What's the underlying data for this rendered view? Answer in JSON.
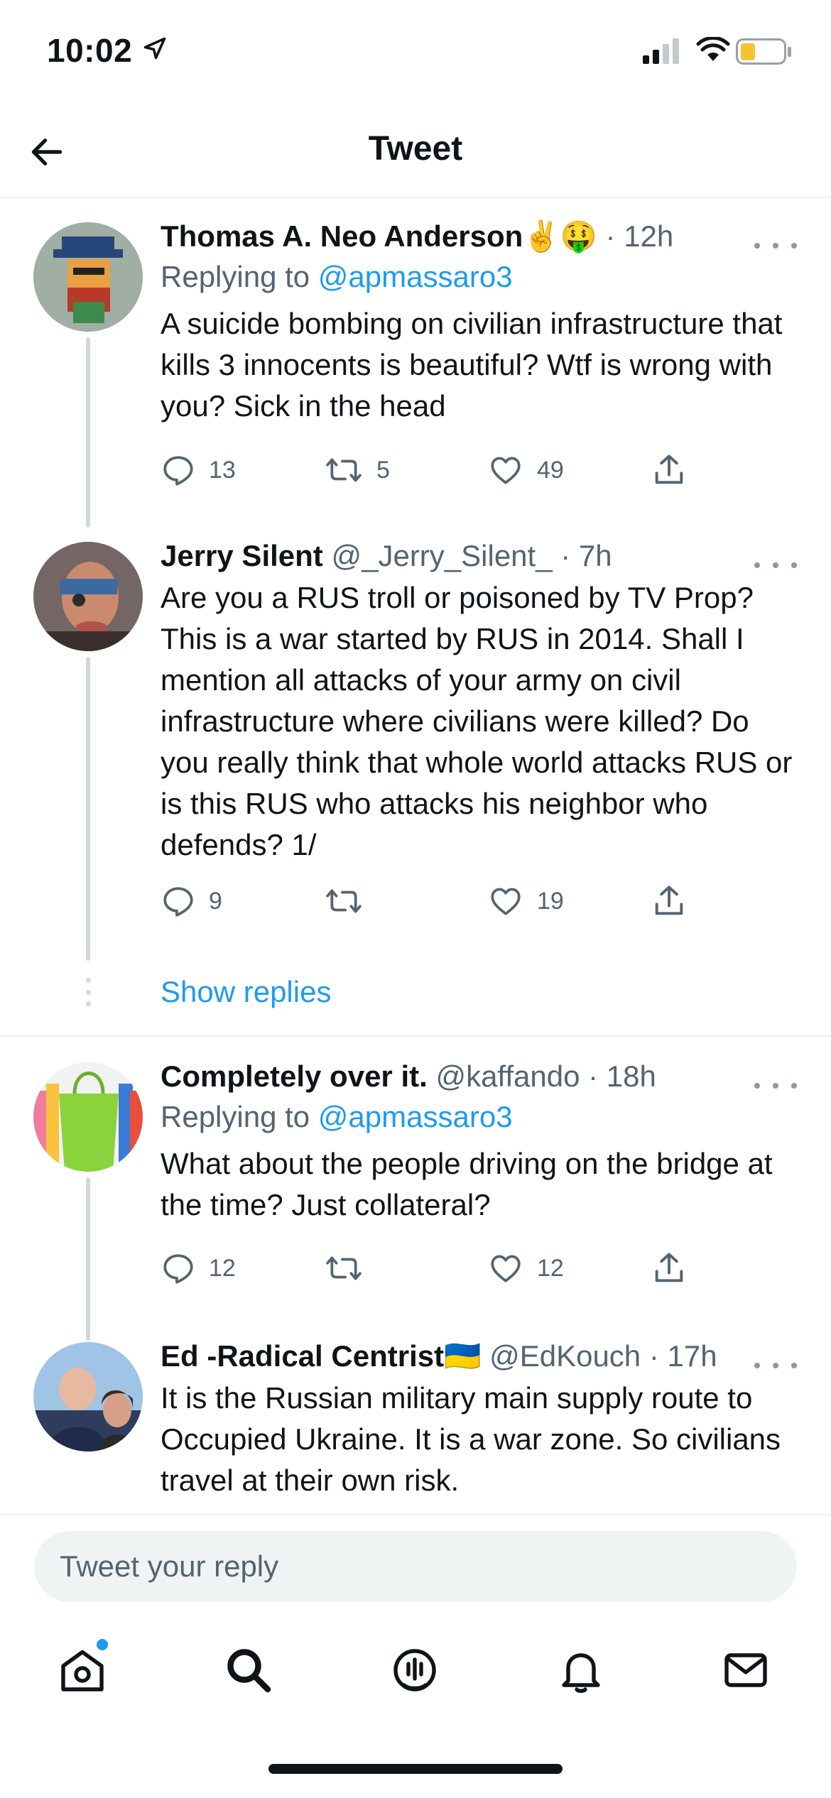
{
  "status_bar": {
    "time": "10:02"
  },
  "header": {
    "title": "Tweet"
  },
  "tweets": [
    {
      "name": "Thomas A. Neo Anderson✌️🤑",
      "handle": "",
      "time": "· 12h",
      "replying_prefix": "Replying to ",
      "replying_to": "@apmassaro3",
      "text": "A suicide bombing on civilian infrastructure that kills 3 innocents is beautiful? Wtf is wrong with you?  Sick in the head",
      "reply_count": "13",
      "retweet_count": "5",
      "like_count": "49"
    },
    {
      "name": "Jerry Silent",
      "handle": "@_Jerry_Silent_",
      "time": "· 7h",
      "text": "Are you a RUS troll or poisoned by TV Prop? This is a war started by RUS in 2014. Shall I mention all attacks of your army on civil infrastructure where civilians were killed? Do you really think that whole world attacks RUS or is this RUS who attacks his neighbor who defends? 1/",
      "reply_count": "9",
      "retweet_count": "",
      "like_count": "19"
    },
    {
      "name": "Completely over it.",
      "handle": "@kaffando",
      "time": "· 18h",
      "replying_prefix": "Replying to ",
      "replying_to": "@apmassaro3",
      "text": "What about the people driving on the bridge at the time? Just collateral?",
      "reply_count": "12",
      "retweet_count": "",
      "like_count": "12"
    },
    {
      "name": "Ed -Radical Centrist🇺🇦",
      "handle": "@EdKouch",
      "time": "· 17h",
      "text": "It is the Russian military  main supply route to Occupied Ukraine. It is a war zone. So civilians travel at their own risk."
    }
  ],
  "show_replies": "Show replies",
  "reply_bar": {
    "placeholder": "Tweet your reply"
  },
  "colors": {
    "accent": "#1d9bf0",
    "text": "#0f1419",
    "muted": "#536471",
    "divider": "#eff3f4"
  },
  "icons": [
    "location-arrow-icon",
    "signal-icon",
    "wifi-icon",
    "battery-icon",
    "back-arrow-icon",
    "more-icon",
    "reply-icon",
    "retweet-icon",
    "like-icon",
    "share-icon",
    "home-icon",
    "search-icon",
    "spaces-icon",
    "notifications-icon",
    "messages-icon"
  ]
}
